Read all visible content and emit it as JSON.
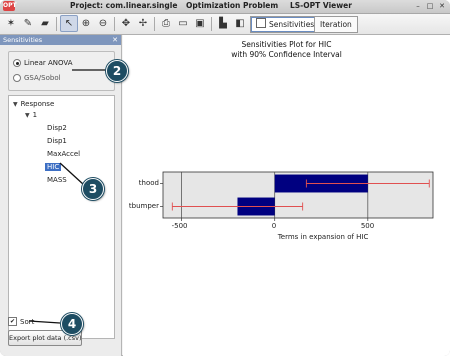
{
  "window": {
    "logo_text": "OPT",
    "project_label": "Project: com.linear.single",
    "subtitle": "Optimization Problem",
    "app_title": "LS-OPT Viewer"
  },
  "toolbar": {
    "view_tabs": [
      {
        "label": "Sensitivities",
        "selected": true
      },
      {
        "label": "Iteration",
        "selected": false
      }
    ]
  },
  "left_panel": {
    "title": "Sensitivities",
    "methods": [
      {
        "label": "Linear ANOVA",
        "selected": true
      },
      {
        "label": "GSA/Sobol",
        "selected": false
      }
    ],
    "tree": {
      "root": "Response",
      "child": "1",
      "items": [
        "Disp2",
        "Disp1",
        "MaxAccel",
        "HIC",
        "MASS"
      ],
      "selected": "HIC"
    },
    "sort": {
      "label": "Sort",
      "checked": true
    },
    "export_label": "Export plot data (.csv)"
  },
  "callouts": [
    "2",
    "3",
    "4"
  ],
  "chart_data": {
    "type": "bar",
    "orientation": "horizontal",
    "title": "Sensitivities Plot for HIC",
    "subtitle": "with 90% Confidence Interval",
    "categories": [
      "thood",
      "tbumper"
    ],
    "values": [
      500,
      -200
    ],
    "ci_low": [
      170,
      -550
    ],
    "ci_high": [
      830,
      150
    ],
    "xlabel": "Terms in expansion of HIC",
    "xticks": [
      "-500",
      "0",
      "500"
    ],
    "xlim": [
      -600,
      850
    ],
    "bar_color": "#000080",
    "ci_color": "#e05050",
    "background": "#e6e6e6"
  }
}
